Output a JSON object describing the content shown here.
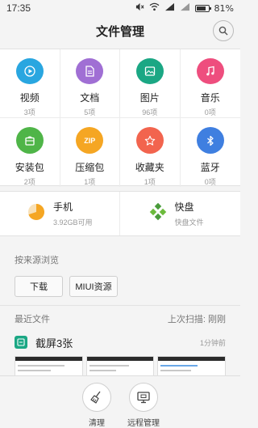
{
  "status": {
    "time": "17:35",
    "battery": "81%",
    "battery_level": 0.81
  },
  "header": {
    "title": "文件管理"
  },
  "categories": [
    {
      "name": "视频",
      "count": "3项",
      "color": "#29a6e0",
      "icon": "play-icon"
    },
    {
      "name": "文档",
      "count": "5项",
      "color": "#a06fd4",
      "icon": "document-icon"
    },
    {
      "name": "图片",
      "count": "96项",
      "color": "#1ba784",
      "icon": "picture-icon"
    },
    {
      "name": "音乐",
      "count": "0项",
      "color": "#ee4e7e",
      "icon": "music-note-icon"
    },
    {
      "name": "安装包",
      "count": "2项",
      "color": "#4fb548",
      "icon": "package-icon"
    },
    {
      "name": "压缩包",
      "count": "1项",
      "color": "#f5a623",
      "icon": "zip-icon",
      "glyph": "ZIP"
    },
    {
      "name": "收藏夹",
      "count": "1项",
      "color": "#f2644e",
      "icon": "star-icon"
    },
    {
      "name": "蓝牙",
      "count": "0项",
      "color": "#3f7fe0",
      "icon": "bluetooth-icon"
    }
  ],
  "storage": {
    "phone": {
      "name": "手机",
      "detail": "3.92GB可用",
      "icon": "pie-storage-icon",
      "used_fraction": 0.7
    },
    "kuaipan": {
      "name": "快盘",
      "detail": "快盘文件",
      "icon": "kuaipan-icon"
    }
  },
  "browse": {
    "label": "按来源浏览",
    "sources": [
      "下载",
      "MIUI资源"
    ]
  },
  "recent": {
    "label": "最近文件",
    "last_scan": "上次扫描: 刚刚",
    "group_title": "截屏3张",
    "group_time": "1分钟前"
  },
  "bottom": {
    "clean": "清理",
    "remote": "远程管理"
  },
  "colors": {
    "accent_green": "#1ba784",
    "pie_orange": "#f5a623",
    "kuaipan_green": "#4a9b3b"
  }
}
